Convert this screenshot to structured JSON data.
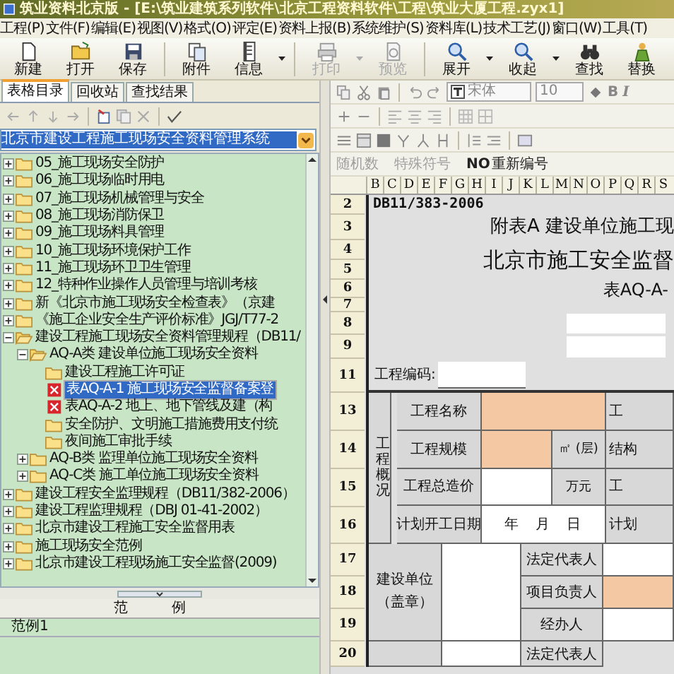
{
  "window": {
    "title": "筑业资料北京版 - [E:\\筑业建筑系列软件\\北京工程资料软件\\工程\\筑业大厦工程.zyx1]"
  },
  "menu": [
    "工程(P)",
    "文件(F)",
    "编辑(E)",
    "视图(V)",
    "格式(O)",
    "评定(E)",
    "资料上报(B)",
    "系统维护(S)",
    "资料库(L)",
    "技术工艺(J)",
    "窗口(W)",
    "工具(T)"
  ],
  "toolbar": [
    {
      "label": "新建",
      "disabled": false,
      "dropdown": false
    },
    {
      "label": "打开",
      "disabled": false,
      "dropdown": false
    },
    {
      "label": "保存",
      "disabled": false,
      "dropdown": false
    },
    {
      "label": "附件",
      "disabled": false,
      "dropdown": false
    },
    {
      "label": "信息",
      "disabled": false,
      "dropdown": true
    },
    {
      "label": "打印",
      "disabled": true,
      "dropdown": true
    },
    {
      "label": "预览",
      "disabled": true,
      "dropdown": false
    },
    {
      "label": "展开",
      "disabled": false,
      "dropdown": true
    },
    {
      "label": "收起",
      "disabled": false,
      "dropdown": true
    },
    {
      "label": "查找",
      "disabled": false,
      "dropdown": false
    },
    {
      "label": "替换",
      "disabled": false,
      "dropdown": false
    }
  ],
  "left_tabs": [
    {
      "label": "表格目录",
      "selected": true
    },
    {
      "label": "回收站",
      "selected": false
    },
    {
      "label": "查找结果",
      "selected": false
    }
  ],
  "catalog_select": {
    "value": "北京市建设工程施工现场安全资料管理系统"
  },
  "tree": [
    {
      "label": "05_施工现场安全防护",
      "kind": "folder",
      "expanded": false,
      "selected": false
    },
    {
      "label": "06_施工现场临时用电",
      "kind": "folder",
      "expanded": false,
      "selected": false
    },
    {
      "label": "07_施工现场机械管理与安全",
      "kind": "folder",
      "expanded": false,
      "selected": false
    },
    {
      "label": "08_施工现场消防保卫",
      "kind": "folder",
      "expanded": false,
      "selected": false
    },
    {
      "label": "09_施工现场料具管理",
      "kind": "folder",
      "expanded": false,
      "selected": false
    },
    {
      "label": "10_施工现场环境保护工作",
      "kind": "folder",
      "expanded": false,
      "selected": false
    },
    {
      "label": "11_施工现场环卫卫生管理",
      "kind": "folder",
      "expanded": false,
      "selected": false
    },
    {
      "label": "12_特种作业操作人员管理与培训考核",
      "kind": "folder",
      "expanded": false,
      "selected": false
    },
    {
      "label": "新《北京市施工现场安全检查表》（京建",
      "kind": "folder",
      "expanded": false,
      "selected": false
    },
    {
      "label": "《施工企业安全生产评价标准》JGJ/T77-2",
      "kind": "folder",
      "expanded": false,
      "selected": false
    },
    {
      "label": "建设工程施工现场安全资料管理规程（DB11/",
      "kind": "folder",
      "expanded": true,
      "selected": false,
      "children": [
        {
          "label": "AQ-A类 建设单位施工现场安全资料",
          "kind": "folder",
          "expanded": true,
          "selected": false,
          "children": [
            {
              "label": "建设工程施工许可证",
              "kind": "folder",
              "selected": false
            },
            {
              "label": "表AQ-A-1 施工现场安全监督备案登",
              "kind": "form",
              "selected": true
            },
            {
              "label": "表AQ-A-2 地上、地下管线及建（构",
              "kind": "form",
              "selected": false
            },
            {
              "label": "安全防护、文明施工措施费用支付统",
              "kind": "folder",
              "selected": false
            },
            {
              "label": "夜间施工审批手续",
              "kind": "folder",
              "selected": false
            }
          ]
        },
        {
          "label": "AQ-B类 监理单位施工现场安全资料",
          "kind": "folder",
          "expanded": false,
          "selected": false
        },
        {
          "label": "AQ-C类 施工单位施工现场安全资料",
          "kind": "folder",
          "expanded": false,
          "selected": false
        }
      ]
    },
    {
      "label": "建设工程安全监理规程（DB11/382-2006）",
      "kind": "folder",
      "expanded": false,
      "selected": false
    },
    {
      "label": "建设工程监理规程（DBJ 01-41-2002）",
      "kind": "folder",
      "expanded": false,
      "selected": false
    },
    {
      "label": "北京市建设工程施工安全监督用表",
      "kind": "folder",
      "expanded": false,
      "selected": false
    },
    {
      "label": "施工现场安全范例",
      "kind": "folder",
      "expanded": false,
      "selected": false
    },
    {
      "label": "北京市建设工程现场施工安全监督(2009)",
      "kind": "folder",
      "expanded": false,
      "selected": false
    }
  ],
  "example_panel": {
    "header": "范 例",
    "rows": [
      "范例1"
    ]
  },
  "format_toolbar": {
    "font": "宋体",
    "size": "10",
    "bold": "B",
    "italic": "I"
  },
  "insert_toolbar": [
    {
      "label": "随机数",
      "disabled": true
    },
    {
      "label": "特殊符号",
      "disabled": true
    },
    {
      "label": "重新编号",
      "prefix": "NO",
      "disabled": false
    }
  ],
  "sheet": {
    "columns": [
      "B",
      "C",
      "D",
      "E",
      "F",
      "G",
      "H",
      "I",
      "J",
      "K",
      "L",
      "M",
      "N",
      "O",
      "P",
      "Q",
      "R",
      "S"
    ],
    "rows": [
      "2",
      "3",
      "4",
      "5",
      "6",
      "7",
      "8",
      "9",
      "11",
      "13",
      "14",
      "15",
      "16",
      "17",
      "18",
      "19",
      "20"
    ],
    "header": {
      "code": "DB11/383-2006",
      "appendix": "附表A 建设单位施工现",
      "title": "北京市施工安全监督",
      "form_no": "表AQ-A-",
      "code_label": "工程编码:"
    },
    "overview": {
      "label": "工程概况",
      "rows": [
        {
          "label": "工程名称",
          "highlighted": true,
          "next": "工"
        },
        {
          "label": "工程规模",
          "highlighted": true,
          "unit": "㎡ (层)",
          "next": "结构"
        },
        {
          "label": "工程总造价",
          "highlighted": false,
          "unit": "万元",
          "next": "工"
        },
        {
          "label": "计划开工日期",
          "date": "年　月　日",
          "next": "计划"
        }
      ]
    },
    "parties": {
      "label": "建设单位（盖章）",
      "rows": [
        {
          "label": "法定代表人",
          "highlighted": false
        },
        {
          "label": "项目负责人",
          "highlighted": true
        },
        {
          "label": "经办人",
          "highlighted": false
        }
      ],
      "next_label": "法定代表人"
    }
  }
}
